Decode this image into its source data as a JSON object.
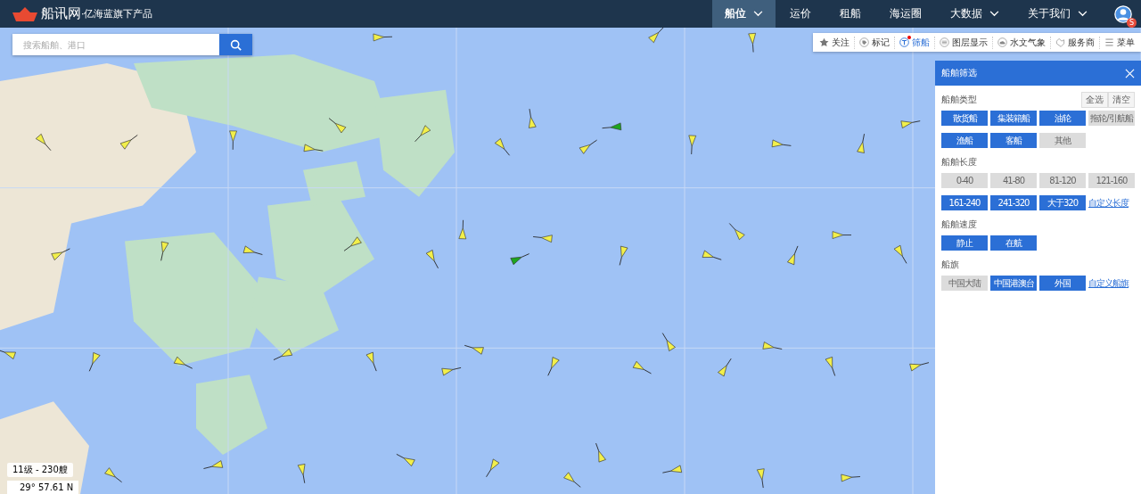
{
  "header": {
    "logo_text": "船讯网",
    "tagline": "·亿海蓝旗下产品",
    "avatar_badge": "S",
    "nav": [
      {
        "label": "船位",
        "selected": true,
        "dropdown": true
      },
      {
        "label": "运价",
        "selected": false,
        "dropdown": false
      },
      {
        "label": "租船",
        "selected": false,
        "dropdown": false
      },
      {
        "label": "海运圈",
        "selected": false,
        "dropdown": false
      },
      {
        "label": "大数据",
        "selected": false,
        "dropdown": true
      },
      {
        "label": "关于我们",
        "selected": false,
        "dropdown": true
      }
    ]
  },
  "search": {
    "placeholder": "搜索船舶、港口"
  },
  "toolbar": [
    {
      "label": "关注",
      "selected": false,
      "dot": false
    },
    {
      "label": "标记",
      "selected": false,
      "dot": false
    },
    {
      "label": "筛船",
      "selected": true,
      "dot": true
    },
    {
      "label": "图层显示",
      "selected": false,
      "dot": false
    },
    {
      "label": "水文气象",
      "selected": false,
      "dot": false
    },
    {
      "label": "服务商",
      "selected": false,
      "dot": false
    },
    {
      "label": "菜单",
      "selected": false,
      "dot": false
    }
  ],
  "filter_panel": {
    "title": "船舶筛选",
    "sections": [
      {
        "title": "船舶类型",
        "actions": [
          "全选",
          "清空"
        ],
        "options": [
          {
            "label": "散货船",
            "selected": true
          },
          {
            "label": "集装箱船",
            "selected": true
          },
          {
            "label": "油轮",
            "selected": true
          },
          {
            "label": "拖轮/引航船",
            "selected": false
          },
          {
            "label": "渔船",
            "selected": true
          },
          {
            "label": "客船",
            "selected": true
          },
          {
            "label": "其他",
            "selected": false
          }
        ]
      },
      {
        "title": "船舶长度",
        "options": [
          {
            "label": "0-40",
            "selected": false
          },
          {
            "label": "41-80",
            "selected": false
          },
          {
            "label": "81-120",
            "selected": false
          },
          {
            "label": "121-160",
            "selected": false
          },
          {
            "label": "161-240",
            "selected": true
          },
          {
            "label": "241-320",
            "selected": true
          },
          {
            "label": "大于320",
            "selected": true
          }
        ],
        "link": "自定义长度"
      },
      {
        "title": "船舶速度",
        "options": [
          {
            "label": "静止",
            "selected": true
          },
          {
            "label": "在航",
            "selected": true
          }
        ]
      },
      {
        "title": "船旗",
        "options": [
          {
            "label": "中国大陆",
            "selected": false
          },
          {
            "label": "中国港澳台",
            "selected": true
          },
          {
            "label": "外国",
            "selected": true
          }
        ],
        "link": "自定义船旗"
      }
    ]
  },
  "map_status": {
    "zoom_info": "11级 - 230艘",
    "coordinate": "29° 57.61 N"
  }
}
